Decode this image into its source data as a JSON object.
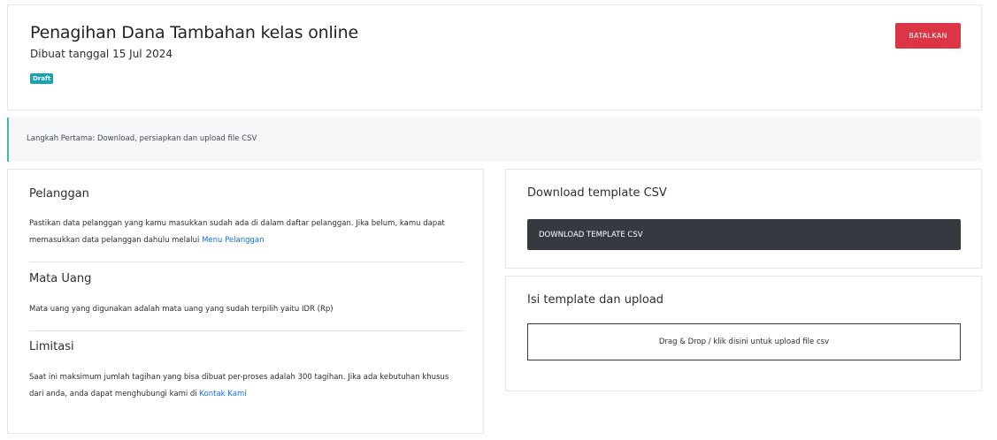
{
  "header": {
    "title": "Penagihan Dana Tambahan kelas online",
    "created": "Dibuat tanggal 15 Jul 2024",
    "status_badge": "Draft",
    "cancel_label": "BATALKAN"
  },
  "step": {
    "text": "Langkah Pertama: Download, persiapkan dan upload file CSV"
  },
  "info": {
    "customer": {
      "title": "Pelanggan",
      "text": "Pastikan data pelanggan yang kamu masukkan sudah ada di dalam daftar pelanggan. Jika belum, kamu dapat memasukkan data pelanggan dahulu melalui",
      "link": "Menu Pelanggan"
    },
    "currency": {
      "title": "Mata Uang",
      "text": "Mata uang yang digunakan adalah mata uang yang sudah terpilih yaitu IDR (Rp)"
    },
    "limits": {
      "title": "Limitasi",
      "text": "Saat ini maksimum jumlah tagihan yang bisa dibuat per-proses adalah 300 tagihan. Jika ada kebutuhan khusus dari anda, anda dapat menghubungi kami di",
      "link": "Kontak Kami"
    }
  },
  "download": {
    "title": "Download template CSV",
    "button_label": "DOWNLOAD TEMPLATE CSV"
  },
  "upload": {
    "title": "Isi template dan upload",
    "dropzone_label": "Drag & Drop / klik disini untuk upload file csv"
  },
  "colors": {
    "danger": "#dc3545",
    "info_badge": "#17a2b8",
    "dark": "#343a40",
    "link": "#0d6efd",
    "step_accent": "#3fb8ad"
  }
}
